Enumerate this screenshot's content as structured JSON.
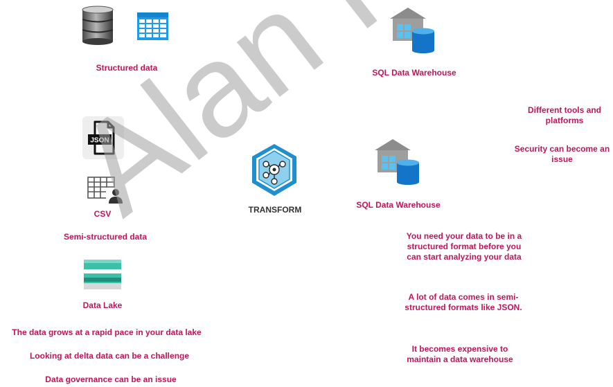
{
  "colors": {
    "label": "#c0155a",
    "transform_label": "#333333",
    "watermark": "#a0a0a0"
  },
  "icons": [
    "database-icon",
    "table-grid-icon",
    "json-file-icon",
    "csv-user-icon",
    "data-lake-icon",
    "transform-icon",
    "sql-data-warehouse-icon"
  ],
  "left": {
    "structured_label": "Structured data",
    "json_badge": "JSON",
    "csv_label": "CSV",
    "semi_structured_label": "Semi-structured data",
    "data_lake_label": "Data Lake",
    "issues": [
      "The data grows at a rapid pace in your data lake",
      "Looking at delta data can be a challenge",
      "Data governance can be an issue"
    ]
  },
  "center": {
    "transform_label": "TRANSFORM"
  },
  "right": {
    "warehouse_top_label": "SQL Data Warehouse",
    "warehouse_mid_label": "SQL Data Warehouse",
    "notes": [
      "Different tools and platforms",
      "Security can become an issue",
      "You need your data to be in a structured format before you can start analyzing your data",
      "A lot of data comes in semi-structured formats like JSON.",
      "It becomes expensive to maintain a data warehouse"
    ]
  },
  "watermark": "Alan Rodrigues"
}
